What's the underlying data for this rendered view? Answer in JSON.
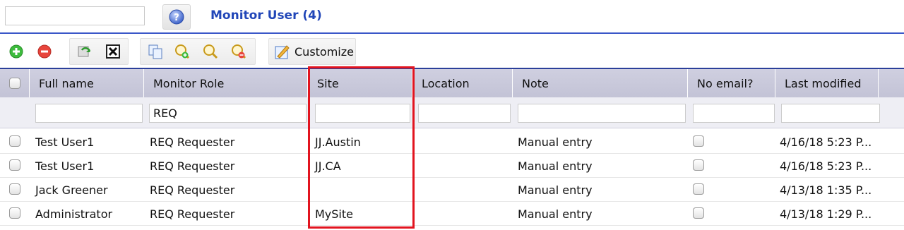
{
  "header": {
    "search_value": "",
    "help_icon": "help-icon",
    "title": "Monitor User (4)",
    "accent_color": "#2146b8"
  },
  "toolbar": {
    "icons": [
      "add-icon",
      "remove-icon",
      "refresh-icon",
      "delete-icon",
      "copy-icon",
      "search-add-icon",
      "search-icon",
      "search-remove-icon",
      "customize-icon"
    ],
    "customize_label": "Customize"
  },
  "table": {
    "columns": [
      "Full name",
      "Monitor Role",
      "Site",
      "Location",
      "Note",
      "No email?",
      "Last modified"
    ],
    "filters": {
      "full_name": "",
      "monitor_role": "REQ",
      "site": "",
      "location": "",
      "note": "",
      "no_email": "",
      "last_modified": ""
    },
    "rows": [
      {
        "full_name": "Test User1",
        "monitor_role": "REQ Requester",
        "site": "JJ.Austin",
        "location": "",
        "note": "Manual entry",
        "no_email": false,
        "last_modified": "4/16/18 5:23 P..."
      },
      {
        "full_name": "Test User1",
        "monitor_role": "REQ Requester",
        "site": "JJ.CA",
        "location": "",
        "note": "Manual entry",
        "no_email": false,
        "last_modified": "4/16/18 5:23 P..."
      },
      {
        "full_name": "Jack Greener",
        "monitor_role": "REQ Requester",
        "site": "",
        "location": "",
        "note": "Manual entry",
        "no_email": false,
        "last_modified": "4/13/18 1:35 P..."
      },
      {
        "full_name": "Administrator",
        "monitor_role": "REQ Requester",
        "site": "MySite",
        "location": "",
        "note": "Manual entry",
        "no_email": false,
        "last_modified": "4/13/18 1:29 P..."
      }
    ]
  },
  "highlight_color": "#e2141f"
}
